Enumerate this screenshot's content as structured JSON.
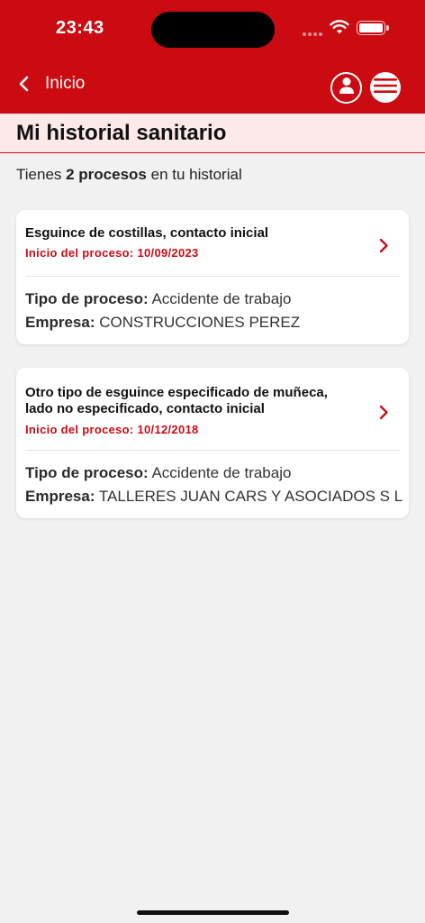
{
  "status": {
    "time": "23:43"
  },
  "header": {
    "back_label": "Inicio"
  },
  "page": {
    "title": "Mi historial sanitario"
  },
  "summary": {
    "prefix": "Tienes ",
    "count_text": "2 procesos",
    "suffix": " en tu historial"
  },
  "processes": [
    {
      "title_lines": [
        "Esguince de costillas, contacto inicial"
      ],
      "date_label": "Inicio del proceso: 10/09/2023",
      "tipo_label": "Tipo de proceso:",
      "tipo_value": "Accidente de trabajo",
      "empresa_label": "Empresa:",
      "empresa_value": "CONSTRUCCIONES PEREZ"
    },
    {
      "title_lines": [
        "Otro tipo de esguince especificado de muñeca,",
        "lado no especificado, contacto inicial"
      ],
      "date_label": "Inicio del proceso: 10/12/2018",
      "tipo_label": "Tipo de proceso:",
      "tipo_value": "Accidente de trabajo",
      "empresa_label": "Empresa:",
      "empresa_value": "TALLERES JUAN CARS Y ASOCIADOS S L"
    }
  ],
  "colors": {
    "brand_red": "#cc0a12",
    "title_band": "#fde8ea",
    "background": "#f1f1f1"
  },
  "icons": {
    "back": "chevron-left-icon",
    "user": "user-icon",
    "menu": "hamburger-menu-icon",
    "row": "chevron-right-icon"
  }
}
